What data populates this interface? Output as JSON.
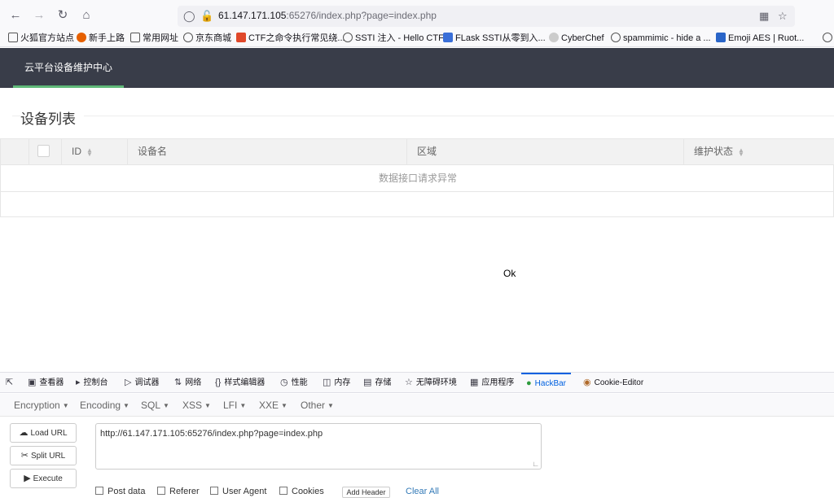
{
  "browser": {
    "url_host": "61.147.171.105",
    "url_path": ":65276/index.php?page=index.php",
    "bookmarks": [
      "火狐官方站点",
      "新手上路",
      "常用网址",
      "京东商城",
      "CTF之命令执行常见绕...",
      "SSTI 注入 - Hello CTF",
      "FLask SSTI从零到入...",
      "CyberChef",
      "spammimic - hide a ...",
      "Emoji AES | Ruot..."
    ]
  },
  "app": {
    "nav_item": "云平台设备维护中心",
    "section_title": "设备列表",
    "table": {
      "columns": [
        "ID",
        "设备名",
        "区域",
        "维护状态"
      ],
      "empty_message": "数据接口请求异常"
    },
    "result_text": "Ok"
  },
  "devtools": {
    "tabs": [
      "查看器",
      "控制台",
      "调试器",
      "网络",
      "样式编辑器",
      "性能",
      "内存",
      "存储",
      "无障碍环境",
      "应用程序",
      "HackBar",
      "Cookie-Editor"
    ],
    "active_tab": "HackBar"
  },
  "hackbar": {
    "menus": [
      "Encryption",
      "Encoding",
      "SQL",
      "XSS",
      "LFI",
      "XXE",
      "Other"
    ],
    "buttons": {
      "load": "Load URL",
      "split": "Split URL",
      "execute": "Execute"
    },
    "url_value": "http://61.147.171.105:65276/index.php?page=index.php",
    "options": [
      "Post data",
      "Referer",
      "User Agent",
      "Cookies"
    ],
    "add_header": "Add Header",
    "clear_all": "Clear All"
  },
  "colors": {
    "header_bg": "#393d49",
    "nav_underline": "#5fb878",
    "devtools_active": "#0061e0"
  }
}
